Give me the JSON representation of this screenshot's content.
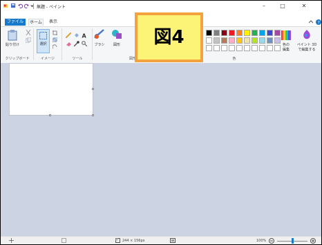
{
  "window": {
    "title": "無題 - ペイント",
    "minimize_glyph": "–",
    "maximize_glyph": "□",
    "close_glyph": "✕"
  },
  "tabs": {
    "file": "ファイル",
    "home": "ホーム",
    "view": "表示"
  },
  "ribbon": {
    "paste_label": "貼り付け",
    "select_label": "選択",
    "brushes_label": "ブラシ",
    "shapes_label": "図形",
    "edit_colors_label": "色の\n編集",
    "paint3d_label": "ペイント 3D\nで編集する",
    "groups": {
      "clipboard": "クリップボード",
      "image": "イメージ",
      "tools": "ツール",
      "shapes": "図形",
      "colors": "色"
    },
    "palette_row1": [
      "#000000",
      "#7f7f7f",
      "#880015",
      "#ed1c24",
      "#ff7f27",
      "#fff200",
      "#22b14c",
      "#00a2e8",
      "#3f48cc",
      "#a349a4"
    ],
    "palette_row2": [
      "#ffffff",
      "#c3c3c3",
      "#b97a57",
      "#ffaec9",
      "#ffc90e",
      "#efe4b0",
      "#b5e61d",
      "#99d9ea",
      "#7092be",
      "#c8bfe7"
    ]
  },
  "callout": {
    "text": "図4"
  },
  "statusbar": {
    "canvas_size": "244 × 156px",
    "zoom": "100%",
    "zoom_level_percent": 100
  },
  "colors": {
    "accent": "#1979ca",
    "workspace": "#ccd4e3",
    "callout_fill": "#fbf477",
    "callout_border": "#f3a33d"
  }
}
